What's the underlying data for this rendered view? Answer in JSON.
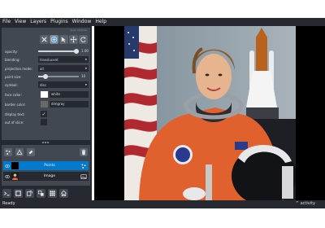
{
  "menu": {
    "items": [
      "File",
      "View",
      "Layers",
      "Plugins",
      "Window",
      "Help"
    ]
  },
  "layer_controls": {
    "dock_title": "layer controls",
    "opacity": {
      "label": "opacity:",
      "value": "1.00",
      "fraction": 1.0
    },
    "blending": {
      "label": "blending:",
      "value": "translucent"
    },
    "projection_mode": {
      "label": "projection mode:",
      "value": "all"
    },
    "point_size": {
      "label": "point size:",
      "value": "10",
      "fraction": 0.18
    },
    "symbol": {
      "label": "symbol:",
      "value": "disc"
    },
    "face_color": {
      "label": "face color:",
      "value": "white",
      "swatch": "#ffffff"
    },
    "border_color": {
      "label": "border color:",
      "value": "dimgray",
      "swatch": "#696969"
    },
    "display_text": {
      "label": "display text:",
      "checked": true
    },
    "out_of_slice": {
      "label": "out of slice:",
      "checked": false
    }
  },
  "layer_list": {
    "dock_title": "layer list",
    "layers": [
      {
        "name": "Points",
        "selected": true
      },
      {
        "name": "Image",
        "selected": false
      }
    ]
  },
  "status": {
    "text": "Ready",
    "activity": "activity",
    "activity_arrow": "^"
  },
  "colors": {
    "panel_bg": "#262930",
    "panel_fg": "#414851",
    "selected": "#007acc",
    "accent": "#50a0f0"
  }
}
